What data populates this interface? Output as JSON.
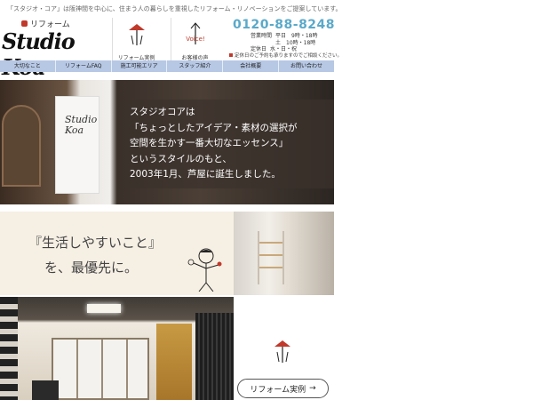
{
  "header": {
    "tagline": "「スタジオ・コア」は阪神間を中心に、住まう人の暮らしを重視したリフォーム・リノベーションをご提案しています。",
    "logo_top": "リフォーム",
    "logo_main": "Studio Koa",
    "icon_reform_label": "リフォーム実例",
    "icon_voice_word": "Voice!",
    "icon_voice_label": "お客様の声",
    "phone": "0120-88-8248",
    "hours_label": "営業時間",
    "hours_weekday": "平日　9時・18時",
    "hours_sat": "土　10時・18時",
    "holiday_label": "定休日",
    "holiday_days": "水・日・祝",
    "note": "定休日のご予約も承りますのでご相談ください。"
  },
  "nav": {
    "items": [
      "大切なこと",
      "リフォームFAQ",
      "施工可能エリア",
      "スタッフ紹介",
      "会社概要",
      "お問い合わせ"
    ]
  },
  "hero": {
    "panel_text": "Studio Koa",
    "lines": [
      "スタジオコアは",
      "「ちょっとしたアイデア・素材の選択が",
      "空間を生かす一番大切なエッセンス」",
      "というスタイルのもと、",
      "2003年1月、芦屋に誕生しました。"
    ]
  },
  "band2": {
    "quote_line1": "『生活しやすいこと』",
    "quote_line2": "を、最優先に。"
  },
  "band3": {
    "button_label": "リフォーム実例",
    "button_arrow": "→"
  },
  "colors": {
    "nav_bg": "#b7c8e5",
    "phone": "#5aa9c9",
    "accent_red": "#c0392b"
  }
}
